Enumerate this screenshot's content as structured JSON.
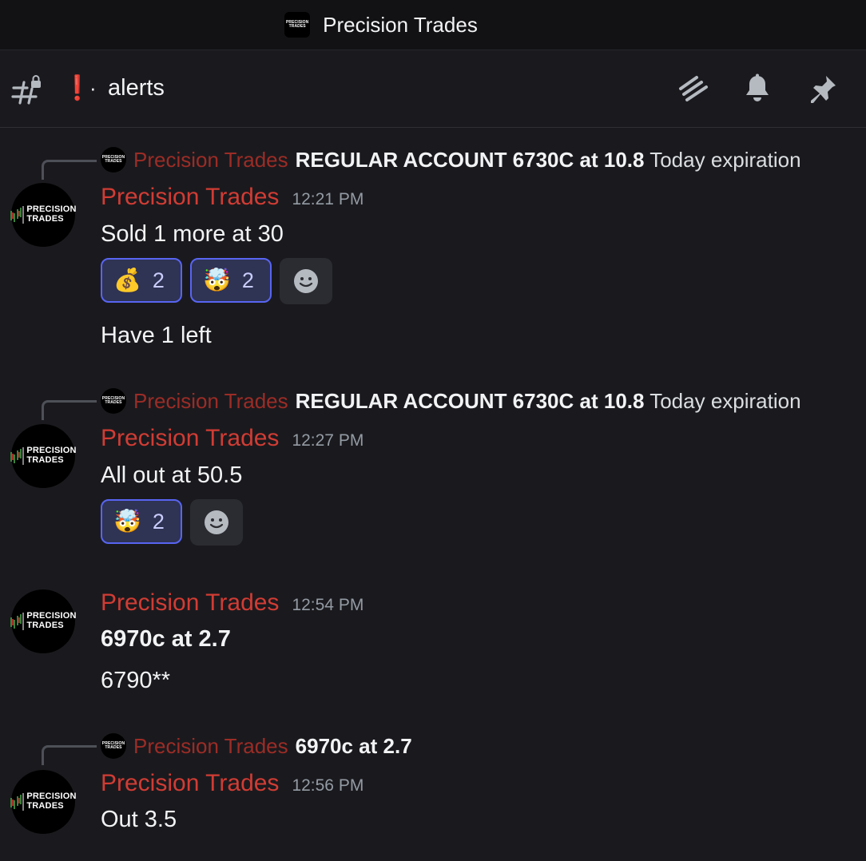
{
  "server": {
    "name": "Precision Trades"
  },
  "channel": {
    "prefix": "·",
    "name": "alerts",
    "alert_glyph": "❗"
  },
  "header_icons": [
    "threads-icon",
    "bell-icon",
    "pin-icon"
  ],
  "logo": {
    "line1": "PRECISION",
    "line2": "TRADES"
  },
  "colors": {
    "author": "#d13c34",
    "reply_author": "#9c2c26",
    "reaction_bg": "#2f3354",
    "reaction_border": "#5865f2"
  },
  "messages": [
    {
      "reply": {
        "author": "Precision Trades",
        "bold": "REGULAR ACCOUNT 6730C at 10.8",
        "rest": " Today expiration"
      },
      "author": "Precision Trades",
      "time": "12:21 PM",
      "text": "Sold 1 more at 30",
      "reactions": [
        {
          "emoji": "💰",
          "count": "2"
        },
        {
          "emoji": "🤯",
          "count": "2"
        }
      ],
      "followup": "Have 1 left"
    },
    {
      "reply": {
        "author": "Precision Trades",
        "bold": "REGULAR ACCOUNT 6730C at 10.8",
        "rest": " Today expiration"
      },
      "author": "Precision Trades",
      "time": "12:27 PM",
      "text": "All out at 50.5",
      "reactions": [
        {
          "emoji": "🤯",
          "count": "2"
        }
      ]
    },
    {
      "author": "Precision Trades",
      "time": "12:54 PM",
      "text": "6970c at 2.7",
      "followup": "6790**"
    },
    {
      "reply": {
        "author": "Precision Trades",
        "bold": "6970c at 2.7",
        "rest": ""
      },
      "author": "Precision Trades",
      "time": "12:56 PM",
      "text": "Out 3.5"
    }
  ]
}
